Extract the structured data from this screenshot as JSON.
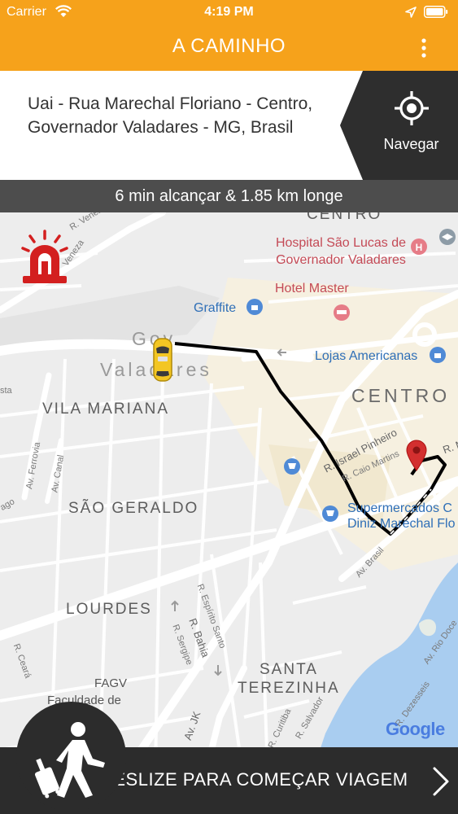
{
  "status_bar": {
    "carrier": "Carrier",
    "time": "4:19 PM"
  },
  "header": {
    "title": "A CAMINHO",
    "background_color": "#f6a21b",
    "menu_icon": "more-vertical-icon"
  },
  "address": {
    "text": "Uai - Rua Marechal Floriano - Centro, Governador Valadares - MG, Brasil"
  },
  "navigate": {
    "label": "Navegar",
    "icon": "crosshair-icon"
  },
  "eta": {
    "text": "6 min alcançar & 1.85 km longe"
  },
  "map": {
    "districts": {
      "centro_top": "CENTRO",
      "centro": "CENTRO",
      "gov_valadares_1": "Gov",
      "gov_valadares_2": "Valadares",
      "vila_mariana": "VILA MARIANA",
      "sao_geraldo": "SÃO GERALDO",
      "lourdes": "LOURDES",
      "santa": "SANTA",
      "terezinha": "TEREZINHA"
    },
    "pois": {
      "hospital": "Hospital São Lucas de Governador Valadares",
      "hotel": "Hotel Master",
      "graffite": "Graffite",
      "lojas": "Lojas Americanas",
      "supermercados": "Supermercados C Diniz Marechal Flo",
      "fagv": "FAGV",
      "faculdade": "Faculdade de Educação"
    },
    "streets": {
      "veneza_1": "R. Veneza",
      "veneza_2": "Veneza",
      "israel": "R. Israel Pinheiro",
      "caio": "R. Caio Martins",
      "brasil": "Av. Brasil",
      "ferrovia": "Av. Ferrovia",
      "canal": "Av. Canal",
      "espirito": "R. Espírito Santo",
      "bahia": "R. Bahia",
      "sergipe": "R. Sergipe",
      "ceara": "R. Ceará",
      "jk": "Av. JK",
      "curitiba": "R. Curitiba",
      "salvador": "R. Salvador",
      "dezesseis": "R. Dezesseis",
      "riodoce": "Av. Rio Doce",
      "r_m": "R. M",
      "sta": "sta",
      "ago": "ago"
    },
    "route_color": "#000000",
    "pin_color": "#d32f2f",
    "alarm_icon": "siren-icon",
    "vehicle_icon": "taxi-icon"
  },
  "attribution": {
    "google": "Google"
  },
  "slider": {
    "label": "DESLIZE PARA COMEÇAR VIAGEM",
    "icon": "walker-luggage-icon"
  }
}
